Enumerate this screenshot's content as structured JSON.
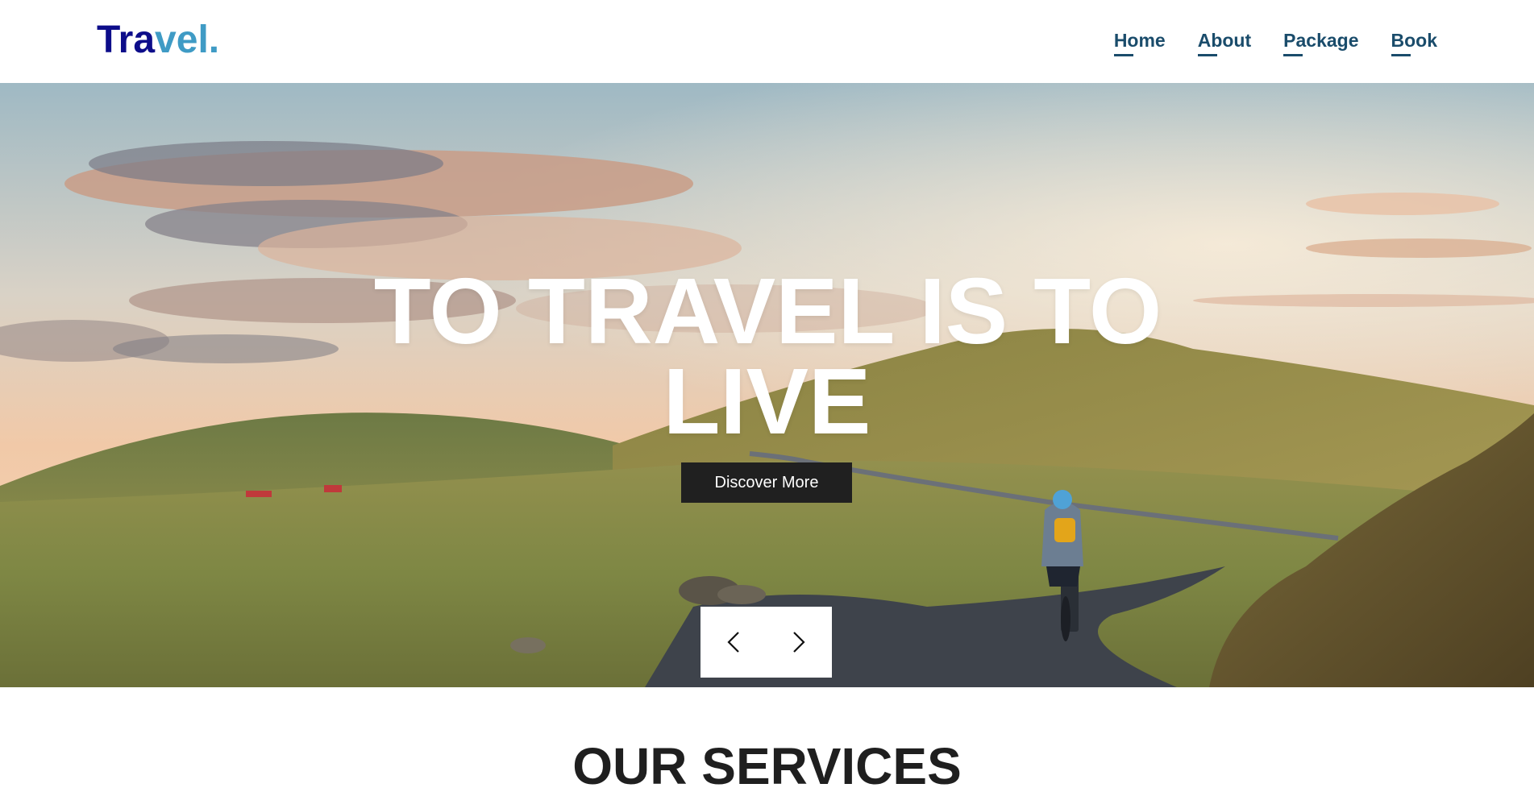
{
  "header": {
    "logo_part1": "Tra",
    "logo_part2": "vel.",
    "nav": [
      {
        "label": "Home"
      },
      {
        "label": "About"
      },
      {
        "label": "Package"
      },
      {
        "label": "Book"
      }
    ]
  },
  "hero": {
    "title_line1": "TO TRAVEL IS TO",
    "title_line2": "LIVE",
    "cta_label": "Discover More",
    "prev_icon": "chevron-left-icon",
    "next_icon": "chevron-right-icon"
  },
  "services": {
    "title": "OUR SERVICES"
  },
  "colors": {
    "logo_dark": "#0d0d8a",
    "logo_light": "#3f9bc5",
    "nav": "#1a4c6b",
    "button": "#202020"
  }
}
